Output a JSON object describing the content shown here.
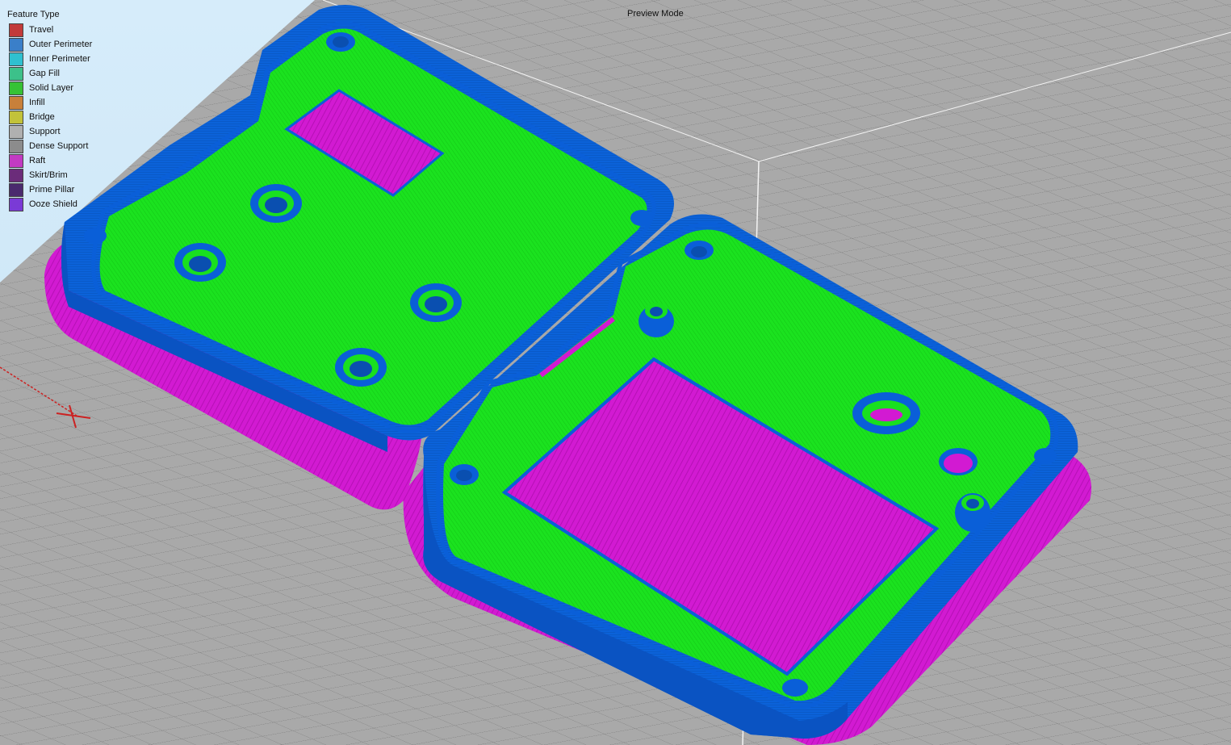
{
  "header": {
    "mode_label": "Preview Mode"
  },
  "legend": {
    "title": "Feature Type",
    "items": [
      {
        "label": "Travel",
        "color": "#c23a3a"
      },
      {
        "label": "Outer Perimeter",
        "color": "#3a7fc9"
      },
      {
        "label": "Inner Perimeter",
        "color": "#2fc0d0"
      },
      {
        "label": "Gap Fill",
        "color": "#3cc18a"
      },
      {
        "label": "Solid Layer",
        "color": "#36c236"
      },
      {
        "label": "Infill",
        "color": "#c8803a"
      },
      {
        "label": "Bridge",
        "color": "#c2c23a"
      },
      {
        "label": "Support",
        "color": "#b0b0b0"
      },
      {
        "label": "Dense Support",
        "color": "#8c8c8c"
      },
      {
        "label": "Raft",
        "color": "#c23ac2"
      },
      {
        "label": "Skirt/Brim",
        "color": "#6b2c7a"
      },
      {
        "label": "Prime Pillar",
        "color": "#4a2a6e"
      },
      {
        "label": "Ooze Shield",
        "color": "#7a3ad6"
      }
    ]
  },
  "colors": {
    "background": "#cfe8f7",
    "build_plate": "#a8a8a8",
    "grid_line": "#7a7a7a",
    "raft": "#d61fd6",
    "outer_perimeter": "#0a5fd8",
    "solid_layer": "#19e01f",
    "travel_axis": "#cc2222"
  }
}
